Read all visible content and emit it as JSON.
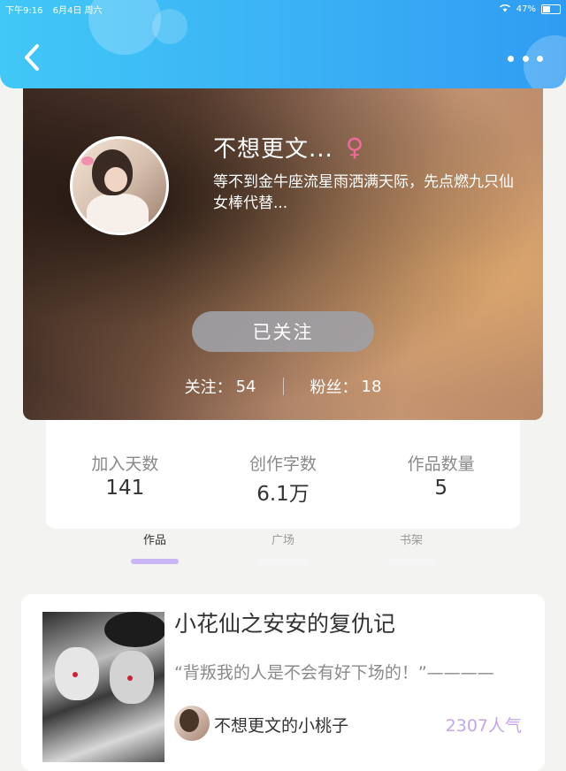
{
  "status_bar": {
    "time": "下午9:16",
    "date": "6月4日 周六",
    "battery": "47%"
  },
  "header": {
    "back_icon": "chevron-left-icon",
    "more_icon": "more-dots-icon"
  },
  "profile": {
    "name": "不想更文...",
    "gender_symbol": "♀",
    "bio": "等不到金牛座流星雨洒满天际，先点燃九只仙女棒代替...",
    "follow_button": "已关注",
    "following_label": "关注：",
    "following_count": "54",
    "fans_label": "粉丝：",
    "fans_count": "18",
    "gender_color": "#ef6a9a"
  },
  "stats": [
    {
      "label": "加入天数",
      "value": "141"
    },
    {
      "label": "创作字数",
      "value": "6.1万"
    },
    {
      "label": "作品数量",
      "value": "5"
    }
  ],
  "tabs": [
    {
      "label": "作品",
      "active": true
    },
    {
      "label": "广场",
      "active": false
    },
    {
      "label": "书架",
      "active": false
    }
  ],
  "work": {
    "title": "小花仙之安安的复仇记",
    "quote": "“背叛我的人是不会有好下场的！”————",
    "author": "不想更文的小桃子",
    "popularity": "2307人气",
    "popularity_color": "#c2a6ee"
  },
  "colors": {
    "header_gradient_start": "#41c8f6",
    "header_gradient_end": "#2f9cf2",
    "active_tab_indicator": "#c9b5f3"
  }
}
